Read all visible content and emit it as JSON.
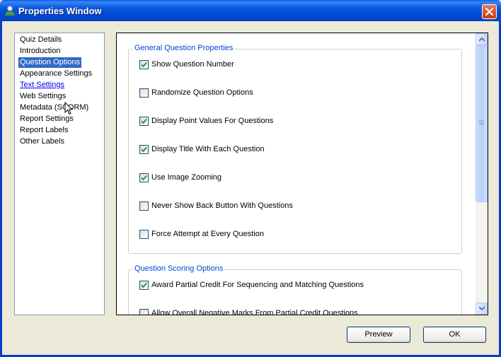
{
  "window": {
    "title": "Properties Window",
    "app_icon": "user-icon",
    "close_icon": "close-icon"
  },
  "nav": {
    "items": [
      {
        "label": "Quiz Details",
        "state": "normal"
      },
      {
        "label": "Introduction",
        "state": "normal"
      },
      {
        "label": "Question Options",
        "state": "selected"
      },
      {
        "label": "Appearance Settings",
        "state": "normal"
      },
      {
        "label": "Text Settings",
        "state": "hover"
      },
      {
        "label": "Web Settings",
        "state": "normal"
      },
      {
        "label": "Metadata (SCORM)",
        "state": "normal"
      },
      {
        "label": "Report Settings",
        "state": "normal"
      },
      {
        "label": "Report Labels",
        "state": "normal"
      },
      {
        "label": "Other Labels",
        "state": "normal"
      }
    ]
  },
  "general": {
    "title": "General Question Properties",
    "options": [
      {
        "label": "Show Question Number",
        "checked": true
      },
      {
        "label": "Randomize Question Options",
        "checked": false
      },
      {
        "label": "Display Point Values For Questions",
        "checked": true
      },
      {
        "label": "Display Title With Each Question",
        "checked": true
      },
      {
        "label": "Use Image Zooming",
        "checked": true
      },
      {
        "label": "Never Show Back Button With Questions",
        "checked": false
      },
      {
        "label": "Force Attempt at Every Question",
        "checked": false
      }
    ]
  },
  "scoring": {
    "title": "Question Scoring Options",
    "options": [
      {
        "label": "Award Partial Credit For Sequencing and Matching Questions",
        "checked": true
      },
      {
        "label": "Allow Overall Negative Marks From Partial Credit Questions",
        "checked": false
      }
    ]
  },
  "buttons": {
    "preview": "Preview",
    "ok": "OK"
  },
  "scrollbar": {
    "up_icon": "arrow-up-icon",
    "down_icon": "arrow-down-icon",
    "position": 0.0
  },
  "colors": {
    "selected_bg": "#316ac5",
    "group_label": "#0046d5",
    "titlebar": "#0a5ae0"
  }
}
